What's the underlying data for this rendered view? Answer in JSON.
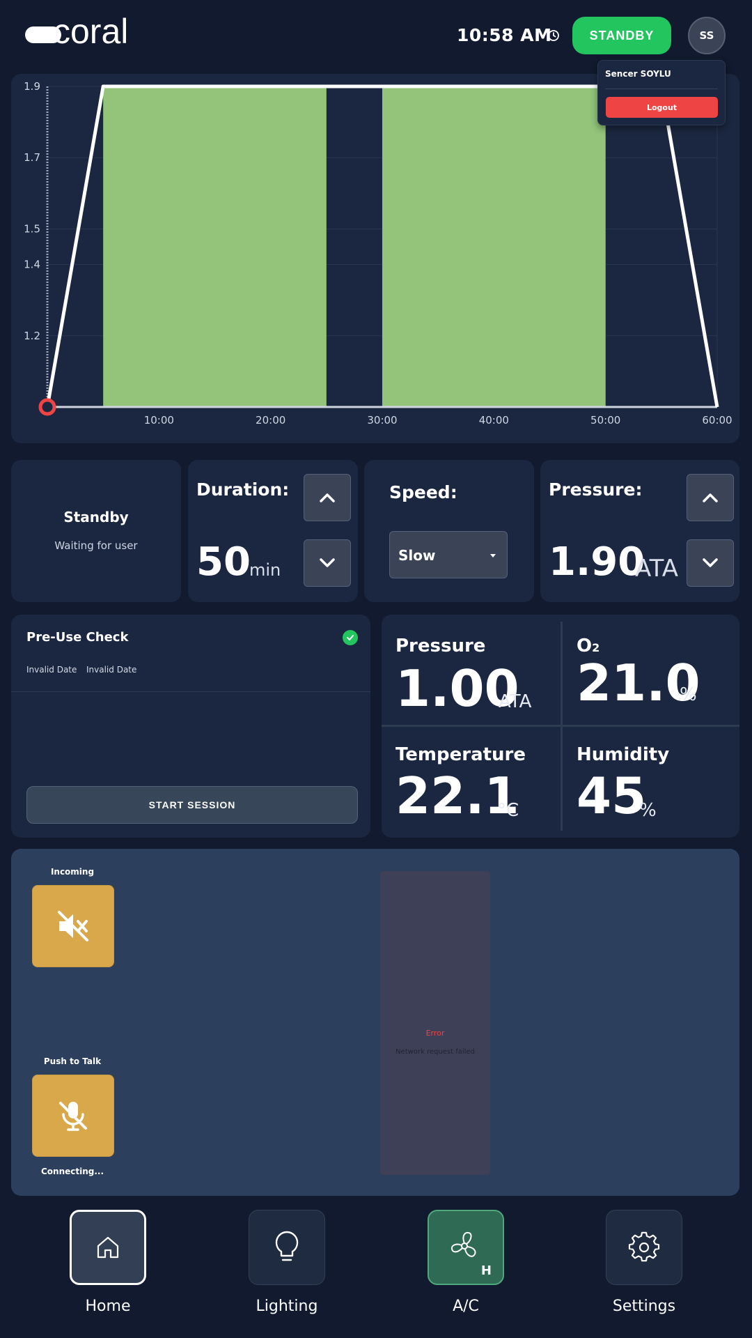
{
  "header": {
    "brand": "coral",
    "time": "10:58 AM",
    "status_button": "STANDBY",
    "avatar_initials": "SS"
  },
  "user_menu": {
    "name": "Sencer SOYLU",
    "logout": "Logout"
  },
  "chart_data": {
    "type": "area",
    "title": "",
    "xlabel": "",
    "ylabel": "",
    "x_ticks": [
      "10:00",
      "20:00",
      "30:00",
      "40:00",
      "50:00",
      "60:00"
    ],
    "y_ticks": [
      "1.2",
      "1.4",
      "1.5",
      "1.7",
      "1.9"
    ],
    "xlim": [
      0,
      60
    ],
    "ylim": [
      1.0,
      1.9
    ],
    "series": [
      {
        "kind": "line",
        "color": "#ffffff",
        "x": [
          0,
          5,
          55,
          60
        ],
        "y": [
          1.0,
          1.9,
          1.9,
          1.0
        ]
      }
    ],
    "blocks": [
      {
        "x_start": 5,
        "x_end": 25,
        "color": "#93c47a"
      },
      {
        "x_start": 30,
        "x_end": 50,
        "color": "#93c47a"
      }
    ],
    "current_x": 0,
    "grid": true
  },
  "status": {
    "title": "Standby",
    "subtitle": "Waiting for user"
  },
  "duration": {
    "label": "Duration:",
    "value": "50",
    "unit": "min"
  },
  "speed": {
    "label": "Speed:",
    "selected": "Slow"
  },
  "pressure_setting": {
    "label": "Pressure:",
    "value": "1.90",
    "unit": "ATA"
  },
  "preuse": {
    "title": "Pre-Use Check",
    "date1": "Invalid Date",
    "date2": "Invalid Date",
    "start_button": "START SESSION"
  },
  "metrics": {
    "pressure": {
      "label": "Pressure",
      "value": "1.00",
      "unit": "ATA"
    },
    "o2": {
      "label": "O",
      "sub": "2",
      "value": "21.0",
      "unit": "%"
    },
    "temperature": {
      "label": "Temperature",
      "value": "22.1",
      "unit": "°C"
    },
    "humidity": {
      "label": "Humidity",
      "value": "45",
      "unit": "%"
    }
  },
  "comms": {
    "incoming_label": "Incoming",
    "ptt_label": "Push to Talk",
    "connecting": "Connecting...",
    "error_title": "Error",
    "error_message": "Network request failed"
  },
  "nav": {
    "home": "Home",
    "lighting": "Lighting",
    "ac": "A/C",
    "ac_badge": "H",
    "settings": "Settings"
  },
  "colors": {
    "background": "#111a2e",
    "panel": "#1b2740",
    "accent_green": "#22c55e",
    "danger": "#ef4444",
    "comm_button": "#d9a84a",
    "chart_block": "#93c47a"
  }
}
